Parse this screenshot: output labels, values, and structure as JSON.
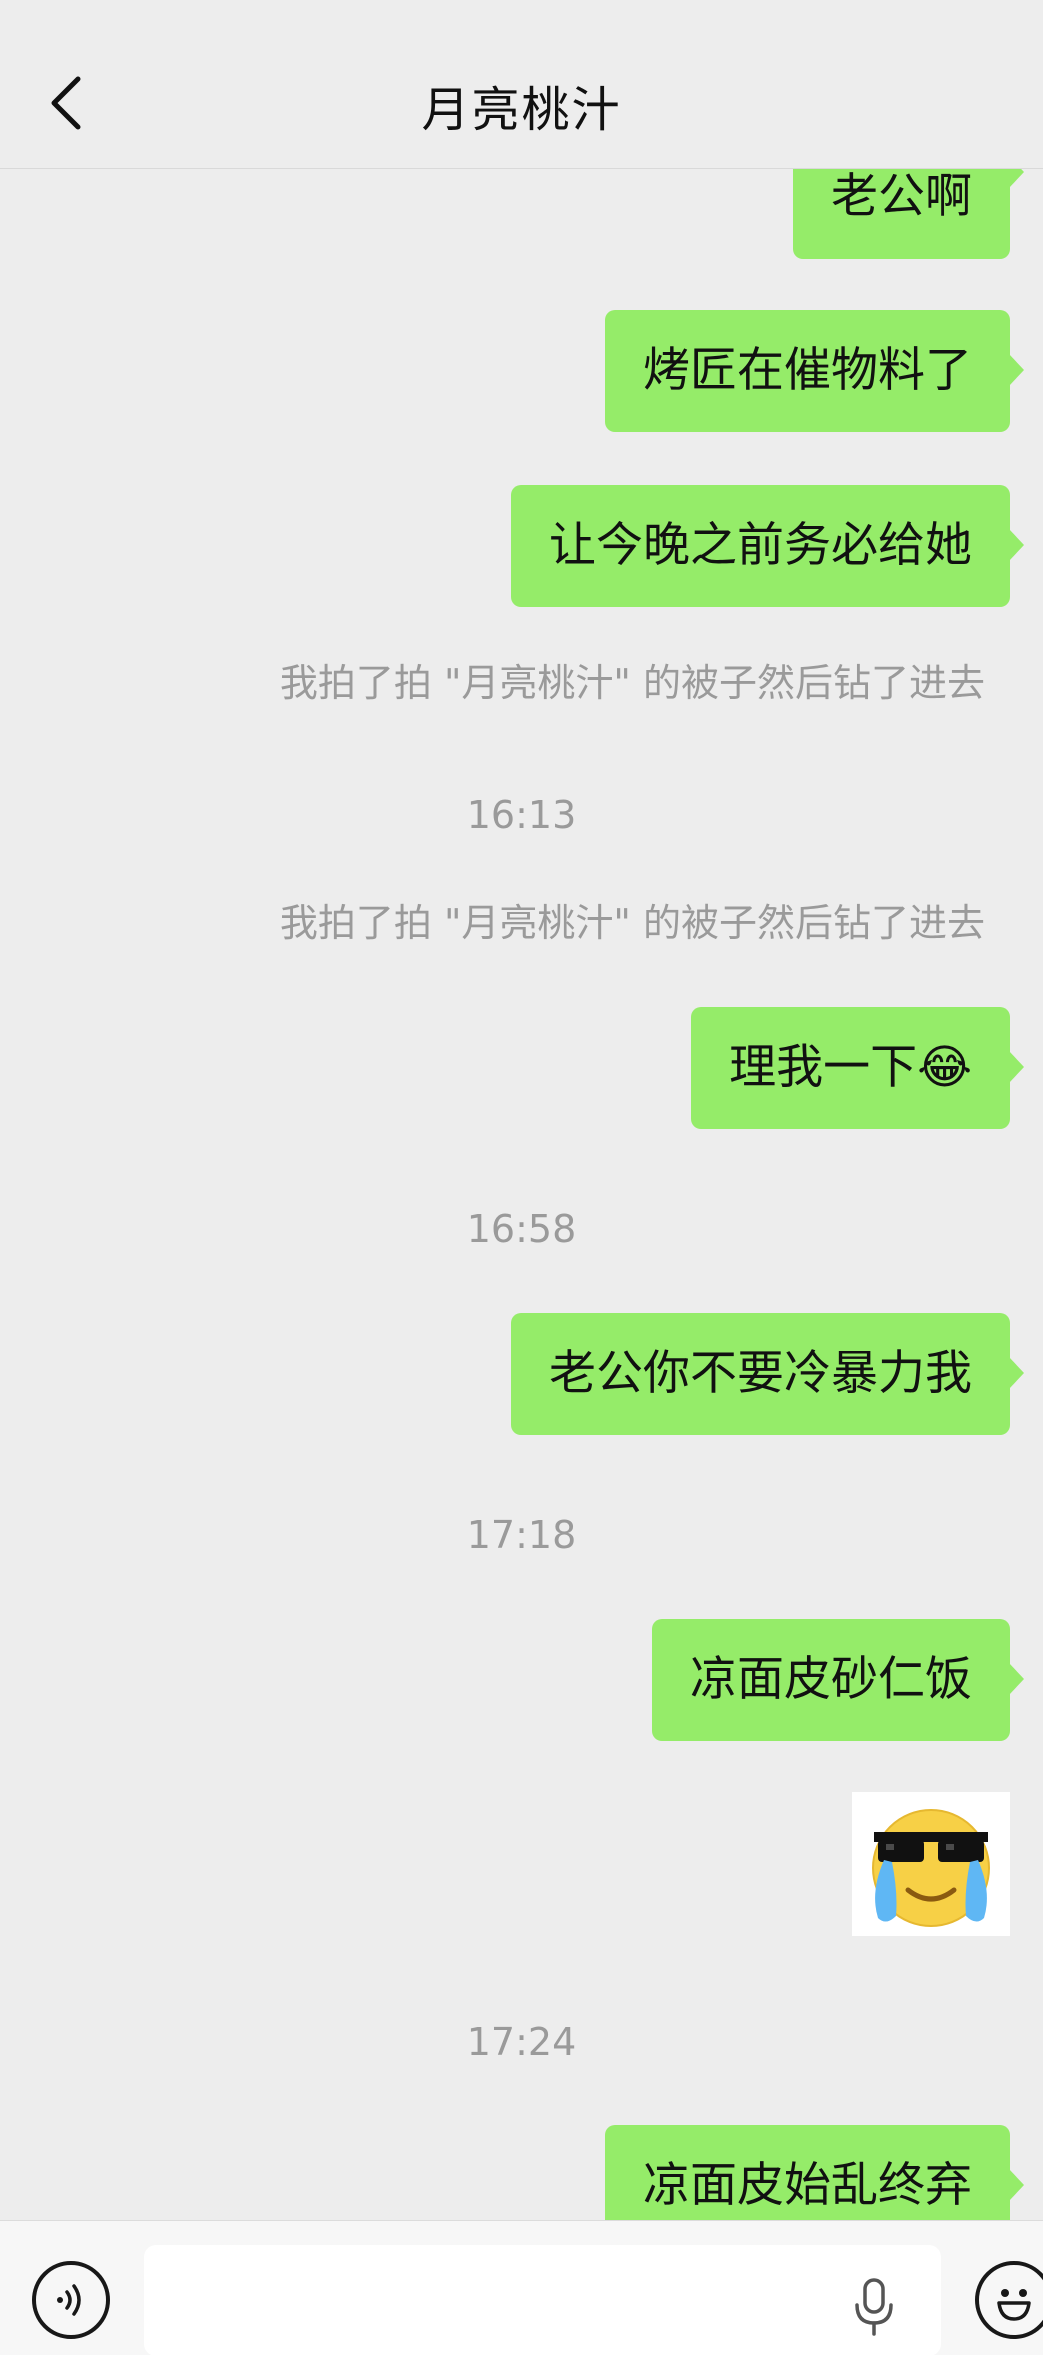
{
  "header": {
    "title": "月亮桃汁",
    "back_icon": "chevron-left-icon"
  },
  "messages": [
    {
      "type": "outgoing",
      "text": "老公啊"
    },
    {
      "type": "outgoing",
      "text": "烤匠在催物料了"
    },
    {
      "type": "outgoing",
      "text": "让今晚之前务必给她"
    },
    {
      "type": "system",
      "text": "我拍了拍 \"月亮桃汁\" 的被子然后钻了进去"
    },
    {
      "type": "timestamp",
      "text": "16:13"
    },
    {
      "type": "system",
      "text": "我拍了拍 \"月亮桃汁\" 的被子然后钻了进去"
    },
    {
      "type": "outgoing",
      "text": "理我一下😂"
    },
    {
      "type": "timestamp",
      "text": "16:58"
    },
    {
      "type": "outgoing",
      "text": "老公你不要冷暴力我"
    },
    {
      "type": "timestamp",
      "text": "17:18"
    },
    {
      "type": "outgoing",
      "text": "凉面皮砂仁饭"
    },
    {
      "type": "sticker",
      "icon": "crying-sunglasses-emoji-sticker"
    },
    {
      "type": "timestamp",
      "text": "17:24"
    },
    {
      "type": "outgoing",
      "text": "凉面皮始乱终弃"
    }
  ],
  "input_bar": {
    "voice_icon": "voice-mode-icon",
    "input_value": "",
    "mic_icon": "microphone-icon",
    "emoji_icon": "emoji-icon"
  },
  "colors": {
    "background": "#ededed",
    "bubble_outgoing": "#95ec69",
    "system_text": "#9a9a9a",
    "input_bar": "#f7f7f7"
  }
}
